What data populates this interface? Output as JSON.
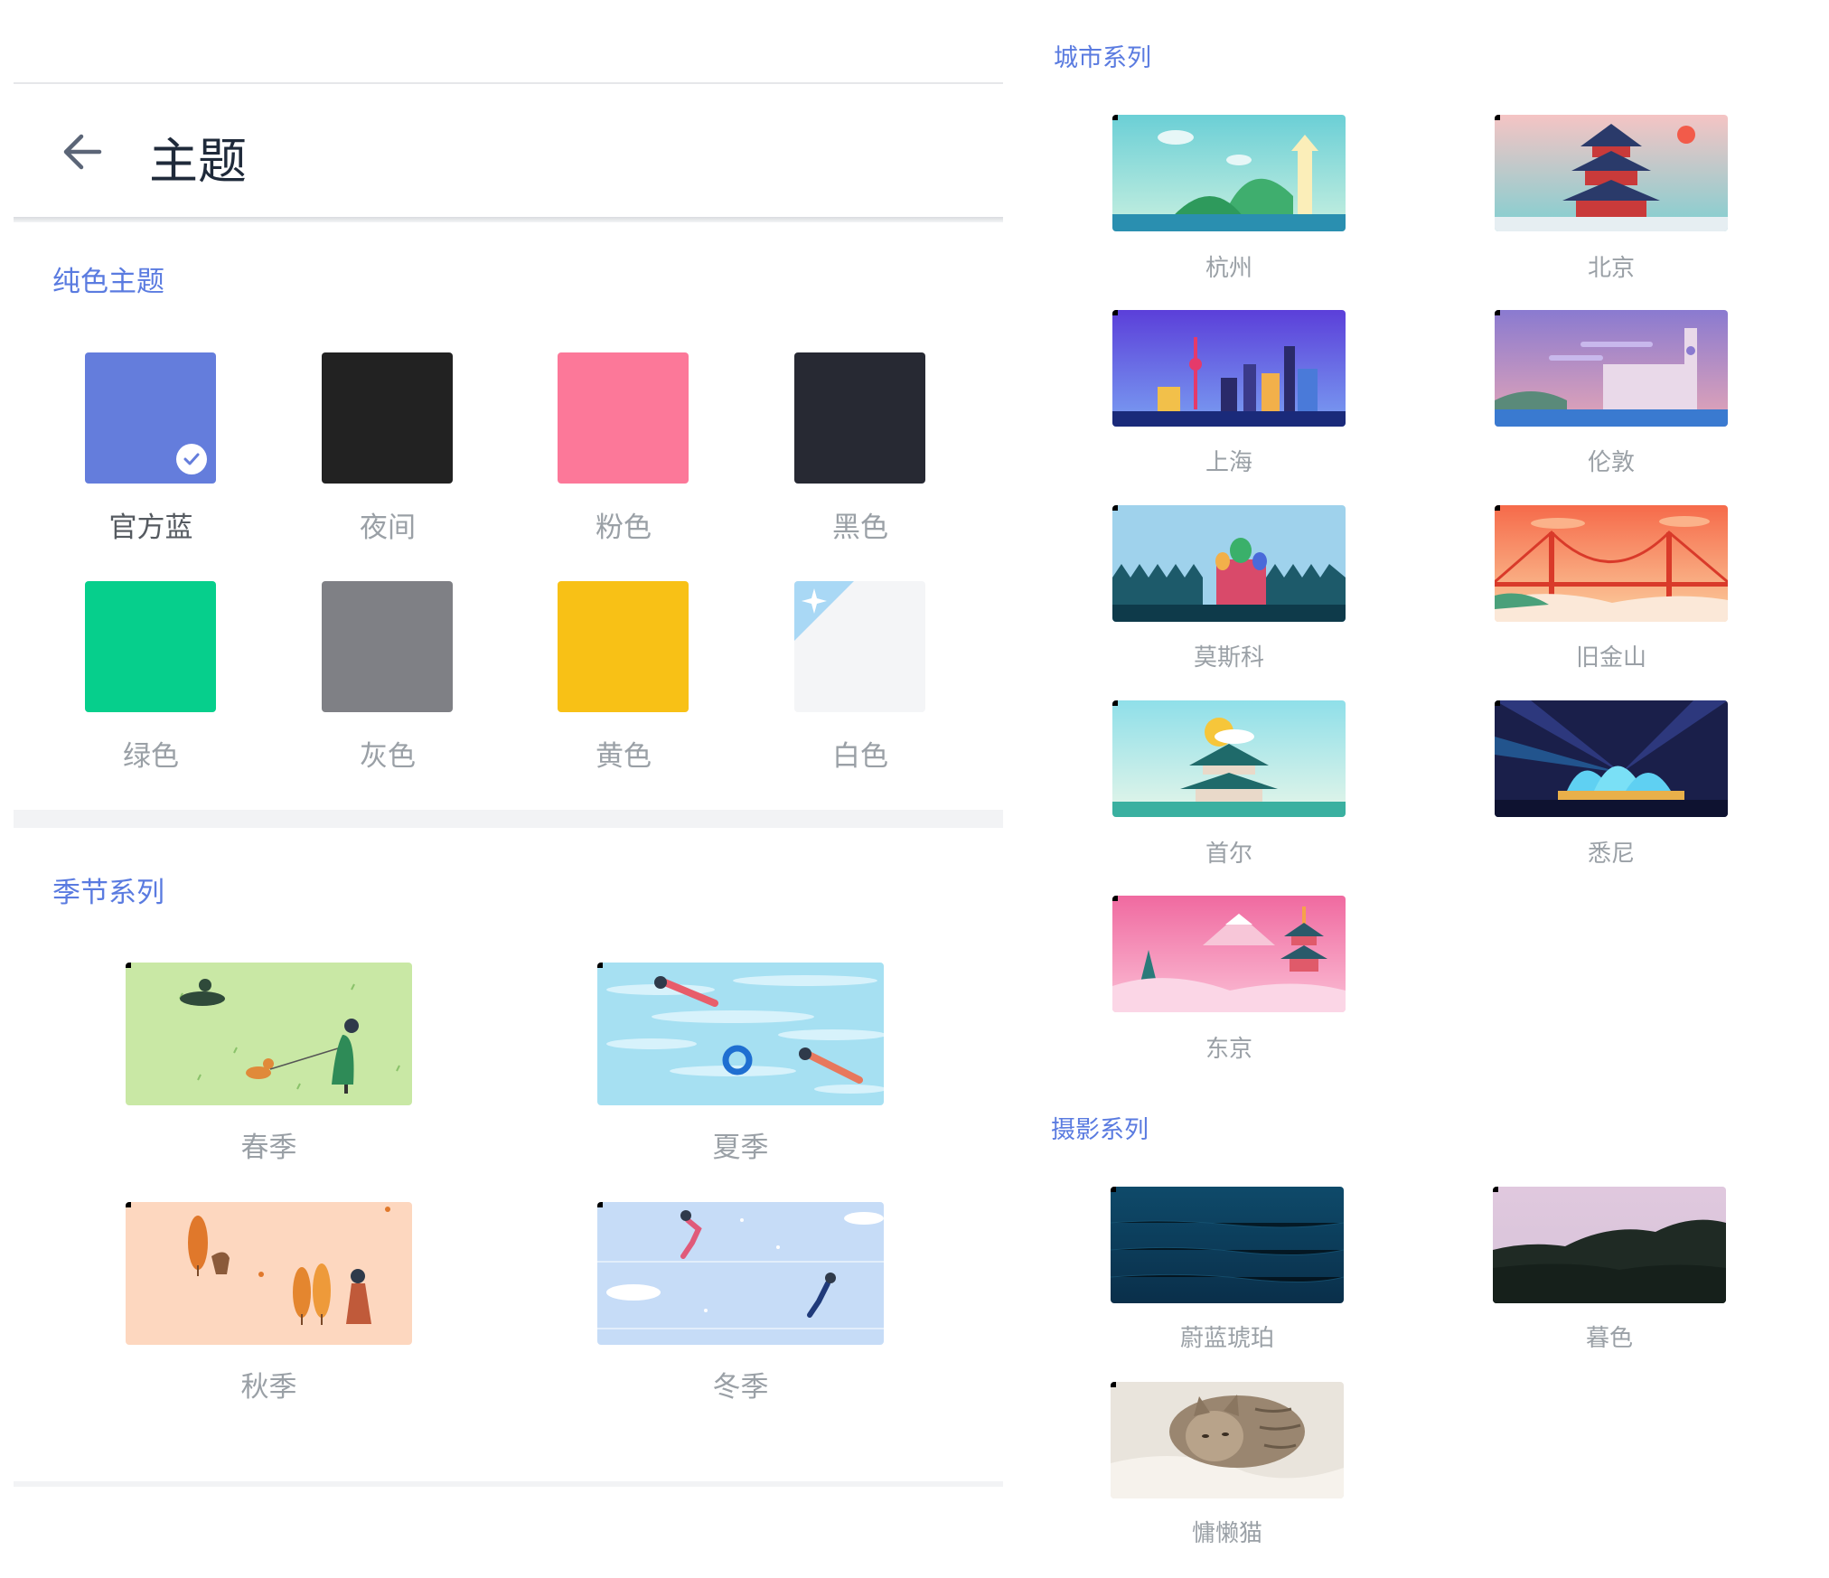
{
  "header": {
    "title": "主题",
    "back_icon": "arrow-left-icon"
  },
  "solid": {
    "title": "纯色主题",
    "items": [
      {
        "label": "官方蓝",
        "color": "#647ddc",
        "selected": true
      },
      {
        "label": "夜间",
        "color": "#222222"
      },
      {
        "label": "粉色",
        "color": "#fc7899"
      },
      {
        "label": "黑色",
        "color": "#272933"
      },
      {
        "label": "绿色",
        "color": "#06cf8c"
      },
      {
        "label": "灰色",
        "color": "#7f8085"
      },
      {
        "label": "黄色",
        "color": "#f8c116"
      },
      {
        "label": "白色",
        "color": "#f4f5f7"
      }
    ]
  },
  "season": {
    "title": "季节系列",
    "items": [
      {
        "label": "春季",
        "badge": "crown-icon"
      },
      {
        "label": "夏季",
        "badge": "crown-icon"
      },
      {
        "label": "秋季",
        "badge": "crown-icon"
      },
      {
        "label": "冬季",
        "badge": "crown-icon"
      }
    ]
  },
  "city": {
    "title": "城市系列",
    "items": [
      {
        "label": "杭州",
        "badge": "crown-icon"
      },
      {
        "label": "北京",
        "badge": "crown-icon"
      },
      {
        "label": "上海",
        "badge": "crown-icon"
      },
      {
        "label": "伦敦",
        "badge": "crown-icon"
      },
      {
        "label": "莫斯科",
        "badge": "crown-icon"
      },
      {
        "label": "旧金山",
        "badge": "crown-icon"
      },
      {
        "label": "首尔",
        "badge": "crown-icon"
      },
      {
        "label": "悉尼",
        "badge": "crown-icon"
      },
      {
        "label": "东京",
        "badge": "crown-icon"
      }
    ]
  },
  "photo": {
    "title": "摄影系列",
    "items": [
      {
        "label": "蔚蓝琥珀",
        "badge": "sparkle-icon"
      },
      {
        "label": "暮色",
        "badge": "heart-icon"
      },
      {
        "label": "慵懒猫",
        "badge": "crown-icon"
      }
    ]
  }
}
